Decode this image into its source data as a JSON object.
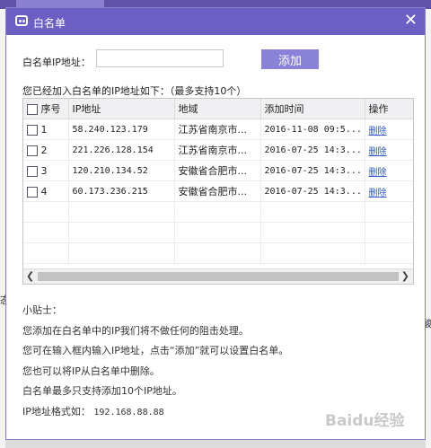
{
  "background": {
    "left_text": "态",
    "right_text": "酸"
  },
  "dialog": {
    "title": "白名单",
    "close_glyph": "✕",
    "ip_label": "白名单IP地址：",
    "ip_input_value": "",
    "add_button": "添加",
    "list_caption": "您已经加入白名单的IP地址如下：（最多支持10个）",
    "table": {
      "headers": [
        "序号",
        "IP地址",
        "地域",
        "添加时间",
        "操作"
      ],
      "rows": [
        {
          "no": "1",
          "ip": "58.240.123.179",
          "region": "江苏省南京市...",
          "time": "2016-11-08 09:5...",
          "action": "删除"
        },
        {
          "no": "2",
          "ip": "221.226.128.154",
          "region": "江苏省南京市...",
          "time": "2016-07-25 14:3...",
          "action": "删除"
        },
        {
          "no": "3",
          "ip": "120.210.134.52",
          "region": "安徽省合肥市...",
          "time": "2016-07-25 14:3...",
          "action": "删除"
        },
        {
          "no": "4",
          "ip": "60.173.236.215",
          "region": "安徽省合肥市...",
          "time": "2016-07-25 14:3...",
          "action": "删除"
        }
      ]
    },
    "tips": {
      "heading": "小贴士：",
      "lines": [
        "您添加在白名单中的IP我们将不做任何的阻击处理。",
        "您可在输入框内输入IP地址，点击“添加”就可以设置白名单。",
        "您也可以将IP从白名单中删除。",
        "白名单最多只支持添加10个IP地址。"
      ],
      "format_label": "IP地址格式如：",
      "format_example": "192.168.88.88"
    }
  },
  "watermark": "Baidu经验",
  "colors": {
    "titlebar": "#6b5fc4",
    "add_button": "#8a82d8",
    "link": "#2b57c8"
  },
  "icons": {
    "title_icon": "chat-bubble-icon",
    "close": "close-icon",
    "scroll_left": "arrow-left-icon",
    "scroll_right": "arrow-right-icon"
  }
}
